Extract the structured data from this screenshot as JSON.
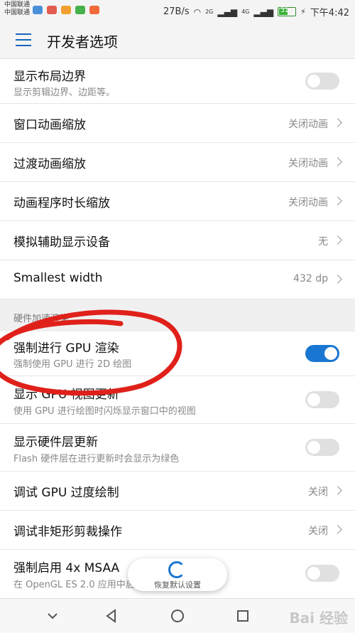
{
  "status_bar": {
    "carrier_1": "中国联通",
    "carrier_2": "中国联通",
    "net_speed": "27B/s",
    "sig_1": "2G",
    "sig_2": "4G",
    "battery_level": "31",
    "time": "下午4:42"
  },
  "header": {
    "title": "开发者选项"
  },
  "rows": [
    {
      "title": "显示布局边界",
      "subtitle": "显示剪辑边界、边距等。",
      "toggle": false
    },
    {
      "title": "窗口动画缩放",
      "value": "关闭动画"
    },
    {
      "title": "过渡动画缩放",
      "value": "关闭动画"
    },
    {
      "title": "动画程序时长缩放",
      "value": "关闭动画"
    },
    {
      "title": "模拟辅助显示设备",
      "value": "无"
    },
    {
      "title": "Smallest width",
      "value": "432 dp"
    }
  ],
  "section": {
    "label": "硬件加速渲染"
  },
  "hw_rows": [
    {
      "title": "强制进行 GPU 渲染",
      "subtitle": "强制使用 GPU 进行 2D 绘图",
      "toggle": true
    },
    {
      "title": "显示 GPU 视图更新",
      "subtitle": "使用 GPU 进行绘图时闪烁显示窗口中的视图",
      "toggle": false
    },
    {
      "title": "显示硬件层更新",
      "subtitle": "Flash 硬件层在进行更新时会显示为绿色",
      "toggle": false
    },
    {
      "title": "调试 GPU 过度绘制",
      "value": "关闭"
    },
    {
      "title": "调试非矩形剪裁操作",
      "value": "关闭"
    },
    {
      "title": "强制启用 4x MSAA",
      "subtitle": "在 OpenGL ES 2.0 应用中启用 4x MSAA",
      "toggle": false
    }
  ],
  "restore_popup": {
    "label": "恢复默认设置"
  },
  "watermark": "Bai 经验",
  "colors": {
    "accent": "#1976d2",
    "annotation": "#e0201a"
  }
}
